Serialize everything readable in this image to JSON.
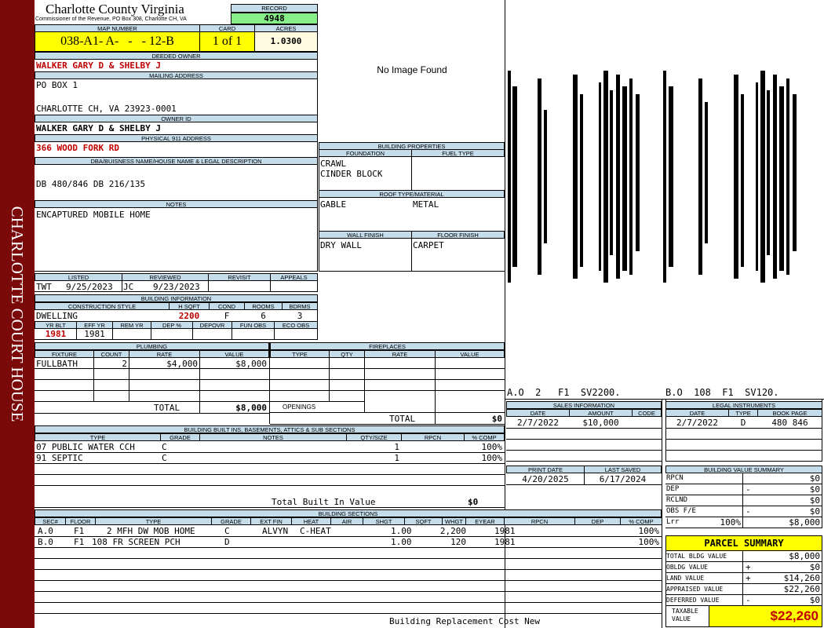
{
  "sidebar": {
    "text": "CHARLOTTE COURT HOUSE"
  },
  "header": {
    "county": "Charlotte County Virginia",
    "subtitle": "Commissioner of the Revenue, PO Box 308, Charlotte CH, VA",
    "record_label": "RECORD",
    "record": "4948",
    "map_label": "MAP NUMBER",
    "map_number": "038-A1- A-   -   - 12-B",
    "card_label": "CARD",
    "card": "1 of 1",
    "acres_label": "ACRES",
    "acres": "1.0300"
  },
  "owner": {
    "deeded_label": "DEEDED OWNER",
    "deeded": "WALKER GARY D & SHELBY J",
    "mailing_label": "MAILING ADDRESS",
    "mailing1": "PO BOX 1",
    "mailing3": "CHARLOTTE CH, VA 23923-0001",
    "owner_id_label": "OWNER ID",
    "owner_id": "WALKER GARY D & SHELBY J",
    "physical_label": "PHYSICAL 911 ADDRESS",
    "physical": "366 WOOD FORK RD",
    "legal_label": "DBA/BUISNESS NAME/HOUSE NAME & LEGAL DESCRIPTION",
    "legal": "DB 480/846 DB 216/135",
    "notes_label": "NOTES",
    "notes": "ENCAPTURED MOBILE HOME"
  },
  "photo": {
    "text": "No Image Found"
  },
  "building_properties": {
    "title": "BUILDING PROPERTIES",
    "foundation_label": "FOUNDATION",
    "fuel_label": "FUEL TYPE",
    "foundation1": "CRAWL",
    "foundation2": "CINDER BLOCK",
    "roof_label": "ROOF TYPE/MATERIAL",
    "roof_type": "GABLE",
    "roof_material": "METAL",
    "wall_label": "WALL FINISH",
    "floor_label": "FLOOR FINISH",
    "wall": "DRY WALL",
    "floor": "CARPET"
  },
  "sketch": {
    "caption_a": "A.O  2   F1  SV2200.",
    "caption_b": "B.O  108  F1  SV120."
  },
  "listing": {
    "listed_label": "LISTED",
    "reviewed_label": "REVIEWED",
    "revisit_label": "REVISIT",
    "appeals_label": "APPEALS",
    "listed_by": "TWT",
    "listed_date": "9/25/2023",
    "reviewed_by": "JC",
    "reviewed_date": "9/23/2023"
  },
  "building_info": {
    "title": "BUILDING INFORMATION",
    "headers": [
      "CONSTRUCTION STYLE",
      "H SQFT",
      "COND",
      "ROOMS",
      "BDRMS"
    ],
    "style": "DWELLING",
    "hsqft": "2200",
    "cond": "F",
    "rooms": "6",
    "bdrms": "3",
    "headers2": [
      "YR BLT",
      "EFF YR",
      "REM YR",
      "DEP %",
      "DEPOVR",
      "FUN OBS",
      "ECO OBS"
    ],
    "yr_blt": "1981",
    "eff_yr": "1981"
  },
  "plumbing": {
    "title": "PLUMBING",
    "headers": [
      "FIXTURE",
      "COUNT",
      "RATE",
      "VALUE"
    ],
    "row": {
      "fixture": "FULLBATH",
      "count": "2",
      "rate": "$4,000",
      "value": "$8,000"
    },
    "total_label": "TOTAL",
    "total": "$8,000"
  },
  "fireplaces": {
    "title": "FIREPLACES",
    "headers": [
      "TYPE",
      "QTY",
      "RATE",
      "VALUE"
    ],
    "openings_label": "OPENINGS",
    "total_label": "TOTAL",
    "total": "$0"
  },
  "builtins": {
    "title": "BUILDING BUILT INS, BASEMENTS, ATTICS & SUB SECTIONS",
    "headers": [
      "TYPE",
      "GRADE",
      "NOTES",
      "QTY/SIZE",
      "RPCN",
      "% COMP"
    ],
    "rows": [
      {
        "type": "07 PUBLIC WATER CCH",
        "grade": "C",
        "qty": "1",
        "comp": "100%"
      },
      {
        "type": "91 SEPTIC",
        "grade": "C",
        "qty": "1",
        "comp": "100%"
      }
    ],
    "total_label": "Total Built In Value",
    "total": "$0"
  },
  "sections": {
    "title": "BUILDING SECTIONS",
    "headers": [
      "SEC#",
      "FLOOR",
      "TYPE",
      "GRADE",
      "EXT FIN",
      "HEAT",
      "AIR",
      "SHGT",
      "SQFT",
      "WHGT",
      "EYEAR",
      "RPCN",
      "DEP",
      "% COMP"
    ],
    "rows": [
      {
        "sec": "A.0",
        "floor": "F1",
        "type": "2 MFH DW MOB HOME",
        "grade": "C",
        "ext": "ALVYN",
        "heat": "C-HEAT",
        "shgt": "1.00",
        "sqft": "2,200",
        "eyear": "1981",
        "comp": "100%"
      },
      {
        "sec": "B.0",
        "floor": "F1",
        "type": "108 FR SCREEN PCH",
        "grade": "D",
        "ext": "",
        "heat": "",
        "shgt": "1.00",
        "sqft": "120",
        "eyear": "1981",
        "comp": "100%"
      }
    ],
    "footer": "Building Replacement Cost New"
  },
  "sales": {
    "title": "SALES INFORMATION",
    "headers": [
      "DATE",
      "AMOUNT",
      "CODE"
    ],
    "date": "2/7/2022",
    "amount": "$10,000"
  },
  "legal_instruments": {
    "title": "LEGAL INSTRUMENTS",
    "headers": [
      "DATE",
      "TYPE",
      "BOOK PAGE"
    ],
    "date": "2/7/2022",
    "type": "D",
    "book_page": "480 846"
  },
  "print": {
    "print_label": "PRINT DATE",
    "saved_label": "LAST SAVED",
    "print_date": "4/20/2025",
    "last_saved": "6/17/2024"
  },
  "bvs": {
    "title": "BUILDING VALUE SUMMARY",
    "rows": [
      {
        "label": "RPCN",
        "pct": "",
        "op": "",
        "value": "$0"
      },
      {
        "label": "DEP",
        "pct": "",
        "op": "-",
        "value": "$0"
      },
      {
        "label": "RCLND",
        "pct": "",
        "op": "",
        "value": "$0"
      },
      {
        "label": "OBS F/E",
        "pct": "",
        "op": "-",
        "value": "$0"
      },
      {
        "label": "Lrr",
        "pct": "100%",
        "op": "",
        "value": "$8,000"
      }
    ]
  },
  "parcel": {
    "title": "PARCEL SUMMARY",
    "rows": [
      {
        "label": "TOTAL BLDG VALUE",
        "op": "",
        "value": "$8,000"
      },
      {
        "label": "OBLDG VALUE",
        "op": "+",
        "value": "$0"
      },
      {
        "label": "LAND VALUE",
        "op": "+",
        "value": "$14,260"
      },
      {
        "label": "APPRAISED VALUE",
        "op": "",
        "value": "$22,260"
      },
      {
        "label": "DEFERRED VALUE",
        "op": "-",
        "value": "$0"
      }
    ],
    "taxable_label1": "TAXABLE",
    "taxable_label2": "VALUE",
    "taxable": "$22,260"
  },
  "colors": {
    "sidebar": "#7a0a0a",
    "header_blue": "#c5dcea",
    "yellow": "#ffff00",
    "green": "#88ee88",
    "red": "#c00000"
  }
}
